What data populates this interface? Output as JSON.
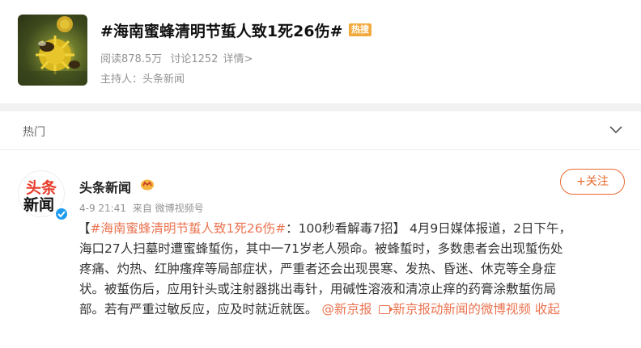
{
  "topic": {
    "title": "#海南蜜蜂清明节蜇人致1死26伤#",
    "badge": "热搜",
    "reads": "阅读878.5万",
    "discussions": "讨论1252",
    "details_link": "详情>",
    "host": "主持人：头条新闻"
  },
  "tabs": {
    "current": "热门"
  },
  "post": {
    "avatar_text_top": "头条",
    "avatar_text_bottom": "新闻",
    "author": "头条新闻",
    "time": "4-9 21:41",
    "source": "来自 微博视频号",
    "follow_label": "+关注",
    "body": {
      "open_bracket": "【",
      "hashtag": "#海南蜜蜂清明节蜇人致1死26伤#",
      "line1_rest": "：100秒看解毒7招】 4月9日媒体报道，2日下午，",
      "line2": "海口27人扫墓时遭蜜蜂蜇伤，其中一71岁老人殒命。被蜂蜇时，多数患者会出现蜇伤处",
      "line3": "疼痛、灼热、红肿瘙痒等局部症状，严重者还会出现畏寒、发热、昏迷、休克等全身症",
      "line4": "状。被蜇伤后，应用针头或注射器挑出毒针，用碱性溶液和清凉止痒的药膏涂敷蜇伤局",
      "line5_text": "部。若有严重过敏反应，应及时就近就医。",
      "mention": "@新京报",
      "video_link": "新京报动新闻的微博视频",
      "collapse": "收起"
    }
  },
  "colors": {
    "accent": "#eb7350",
    "badge": "#f2a93b",
    "verified": "#1d9bf0"
  }
}
